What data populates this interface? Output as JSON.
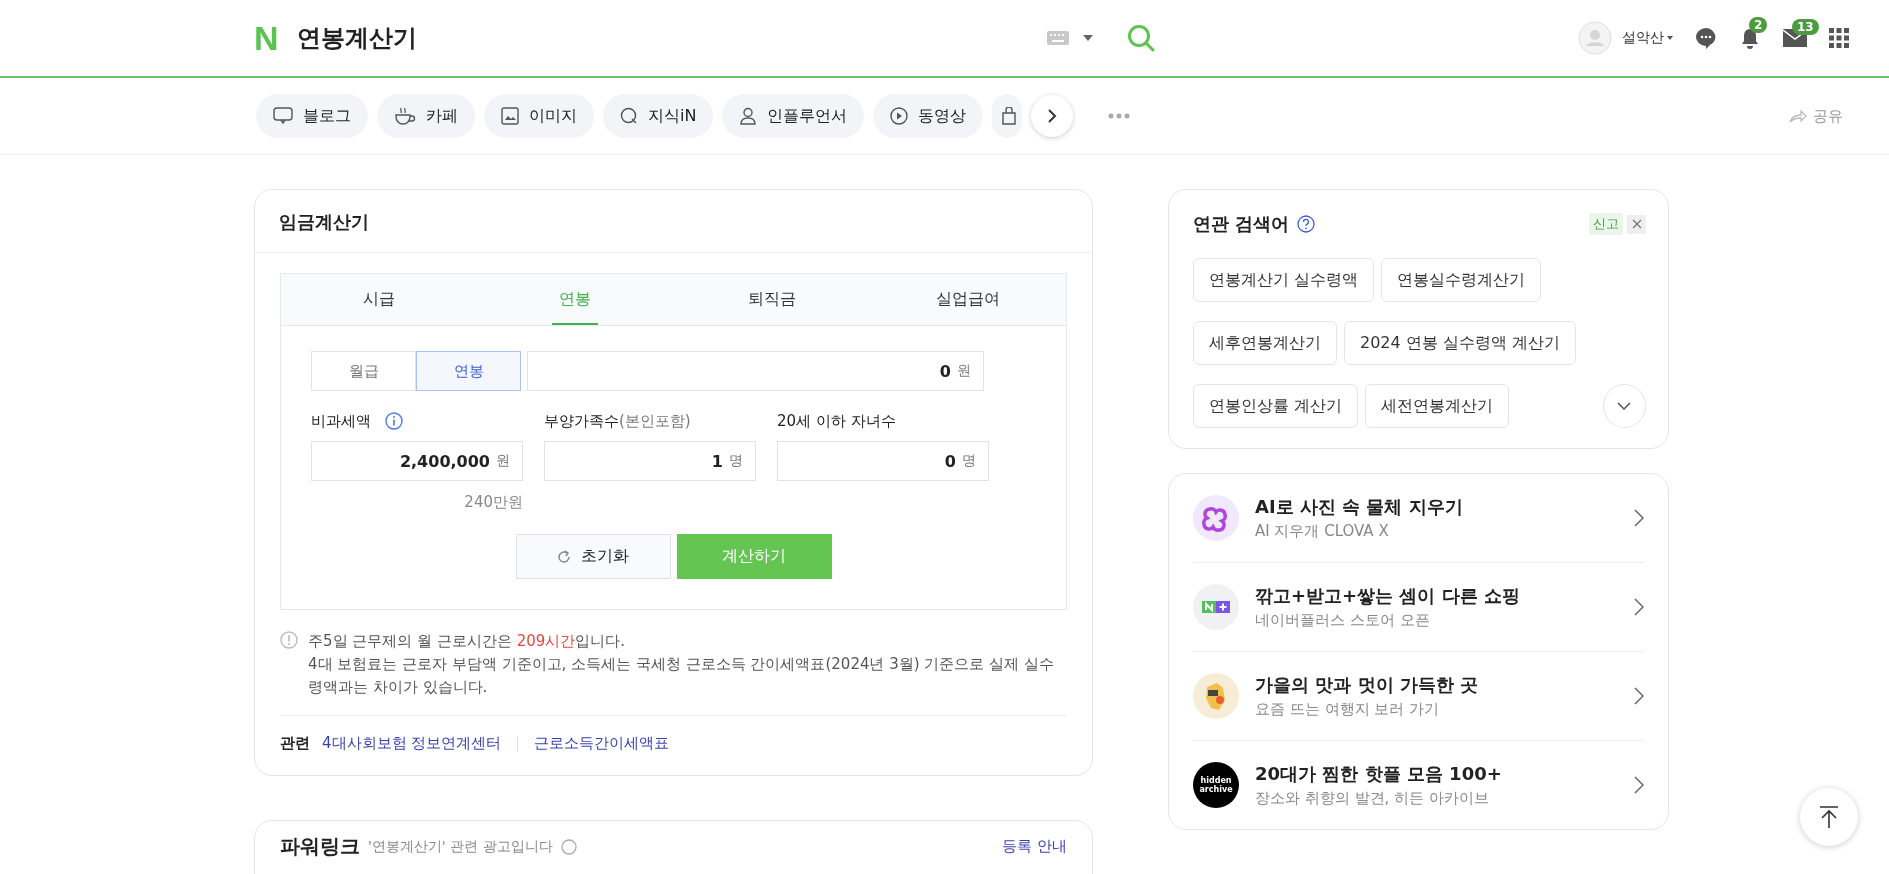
{
  "header": {
    "logo": "N",
    "query": "연봉계산기",
    "user_name": "설악산",
    "notifications": "2",
    "mail": "13"
  },
  "categories": [
    {
      "label": "블로그",
      "kind": "blog"
    },
    {
      "label": "카페",
      "kind": "cafe"
    },
    {
      "label": "이미지",
      "kind": "image"
    },
    {
      "label": "지식iN",
      "kind": "kin"
    },
    {
      "label": "인플루언서",
      "kind": "person"
    },
    {
      "label": "동영상",
      "kind": "video"
    },
    {
      "kind": "bag"
    }
  ],
  "share": "공유",
  "calculator": {
    "title": "임금계산기",
    "tabs": [
      {
        "label": "시급",
        "selected": false
      },
      {
        "label": "연봉",
        "selected": true
      },
      {
        "label": "퇴직금",
        "selected": false
      },
      {
        "label": "실업급여",
        "selected": false
      }
    ],
    "periods": [
      {
        "label": "월급",
        "selected": false
      },
      {
        "label": "연봉",
        "selected": true
      }
    ],
    "amount": {
      "value": "0",
      "unit": "원"
    },
    "fields": [
      {
        "label": "비과세액",
        "info": true,
        "value": "2,400,000",
        "unit": "원"
      },
      {
        "label": "부양가족수",
        "note": "(본인포함)",
        "info": false,
        "value": "1",
        "unit": "명"
      },
      {
        "label": "20세 이하 자녀수",
        "info": false,
        "value": "0",
        "unit": "명"
      }
    ],
    "tax_free_hint": "240만원",
    "reset": "초기화",
    "calculate": "계산하기",
    "note_before": "주5일 근무제의 월 근로시간은 ",
    "note_highlight": "209시간",
    "note_after": "입니다.",
    "note_detail": "4대 보험료는 근로자 부담액 기준이고, 소득세는 국세청 근로소득 간이세액표(2024년 3월) 기준으로 실제 실수령액과는 차이가 있습니다.",
    "related_label": "관련",
    "related_links": [
      "4대사회보험 정보연계센터",
      "근로소득간이세액표"
    ]
  },
  "powerlink": {
    "title": "파워링크",
    "subtitle": "'연봉계산기' 관련 광고입니다",
    "link": "등록 안내"
  },
  "related_searches": {
    "title": "연관 검색어",
    "report": "신고",
    "items": [
      "연봉계산기 실수령액",
      "연봉실수령계산기",
      "세후연봉계산기",
      "2024 연봉 실수령액 계산기",
      "연봉인상률 계산기",
      "세전연봉계산기"
    ]
  },
  "promos": [
    {
      "kind": "clover",
      "title": "AI로 사진 속 물체 지우기",
      "subtitle": "AI 지우개 CLOVA X"
    },
    {
      "kind": "plus",
      "title": "깎고+받고+쌓는 셈이 다른 쇼핑",
      "subtitle": "네이버플러스 스토어 오픈"
    },
    {
      "kind": "map",
      "title": "가을의 맛과 멋이 가득한 곳",
      "subtitle": "요즘 뜨는 여행지 보러 가기"
    },
    {
      "kind": "text",
      "logo_text": "hidden archive",
      "title": "20대가 찜한 핫플 모음 100+",
      "subtitle": "장소와 취향의 발견, 히든 아카이브"
    }
  ]
}
